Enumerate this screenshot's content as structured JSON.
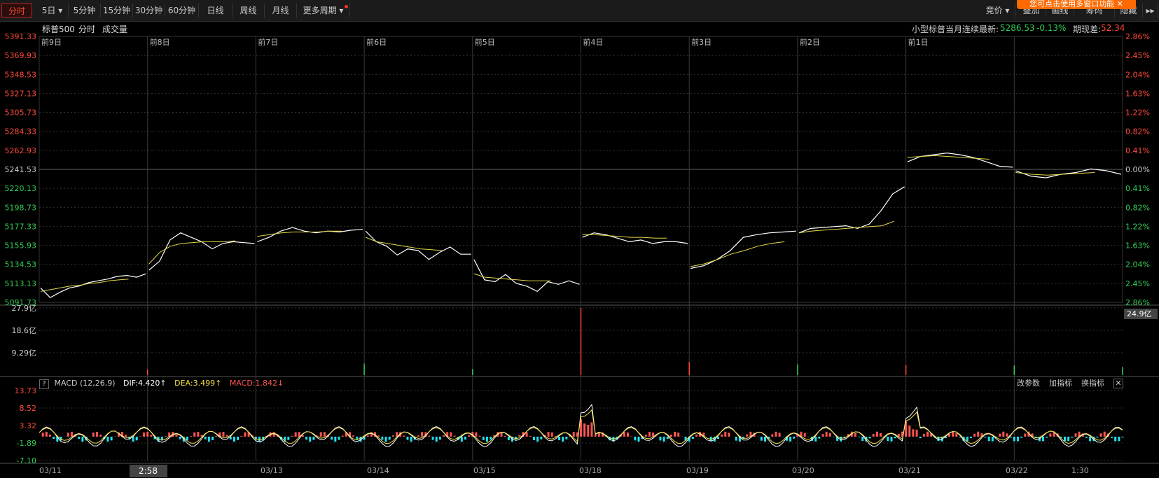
{
  "toolbar": {
    "tabs": [
      {
        "label": "分时",
        "active": true
      },
      {
        "label": "5日 ▾",
        "active": false
      },
      {
        "label": "5分钟",
        "active": false
      },
      {
        "label": "15分钟",
        "active": false
      },
      {
        "label": "30分钟",
        "active": false
      },
      {
        "label": "60分钟",
        "active": false
      },
      {
        "label": "日线",
        "active": false
      },
      {
        "label": "周线",
        "active": false
      },
      {
        "label": "月线",
        "active": false
      },
      {
        "label": "更多周期 ▾",
        "active": false
      }
    ],
    "right_buttons": [
      "竞价 ▾",
      "叠加",
      "画线",
      "筹码",
      "隐藏",
      "▸▸"
    ],
    "notice": "您可点击使用多窗口功能 ✕"
  },
  "header": {
    "symbol": "标普500",
    "mode": "分时",
    "volume_label": "成交量",
    "latest_label": "小型标普当月连续最新:",
    "latest_value": "5286.53",
    "latest_change": "-0.13%",
    "basis_label": "期现差:",
    "basis_value": "52.34"
  },
  "colors": {
    "up": "#ff4a3a",
    "down": "#33cc55",
    "price_line": "#ffffff",
    "avg_line": "#e6d84a",
    "dif_line": "#ffffff",
    "dea_line": "#f5e04a",
    "macd_pos": "#ff5555",
    "macd_neg": "#22e0ee",
    "grid": "#333333"
  },
  "chart_data": {
    "type": "line",
    "price_axis": {
      "ticks": [
        "5391.33",
        "5369.93",
        "5348.53",
        "5327.13",
        "5305.73",
        "5284.33",
        "5262.93",
        "5241.53",
        "5220.13",
        "5198.73",
        "5177.33",
        "5155.93",
        "5134.53",
        "5113.13",
        "5091.73"
      ],
      "pct_ticks": [
        "2.86%",
        "2.45%",
        "2.04%",
        "1.63%",
        "1.22%",
        "0.82%",
        "0.41%",
        "0.00%",
        "0.41%",
        "0.82%",
        "1.22%",
        "1.63%",
        "2.04%",
        "2.45%",
        "2.86%"
      ],
      "ylim": [
        5091.73,
        5391.33
      ],
      "base": 5241.53
    },
    "day_labels": [
      "前9日",
      "前8日",
      "前7日",
      "前6日",
      "前5日",
      "前4日",
      "前3日",
      "前2日",
      "前1日",
      ""
    ],
    "dates": [
      "03/11",
      "03/13",
      "03/14",
      "03/15",
      "03/18",
      "03/19",
      "03/20",
      "03/21",
      "03/22"
    ],
    "time_marks": [
      "2:58",
      "1:30"
    ],
    "days": [
      {
        "price": [
          5108,
          5097,
          5103,
          5108,
          5110,
          5114,
          5116,
          5118,
          5121,
          5122,
          5120,
          5124
        ],
        "avg": [
          5104,
          5106,
          5108,
          5110,
          5111,
          5113,
          5114,
          5116,
          5117,
          5118
        ]
      },
      {
        "price": [
          5128,
          5138,
          5162,
          5170,
          5165,
          5160,
          5152,
          5158,
          5160,
          5159,
          5158
        ],
        "avg": [
          5135,
          5148,
          5155,
          5158,
          5159,
          5160,
          5160,
          5160,
          5161
        ]
      },
      {
        "price": [
          5160,
          5165,
          5172,
          5176,
          5172,
          5170,
          5172,
          5171,
          5173,
          5174
        ],
        "avg": [
          5166,
          5168,
          5170,
          5171,
          5171,
          5171,
          5172,
          5172
        ]
      },
      {
        "price": [
          5172,
          5160,
          5155,
          5145,
          5152,
          5150,
          5140,
          5148,
          5154,
          5146,
          5146
        ],
        "avg": [
          5165,
          5160,
          5158,
          5156,
          5154,
          5152,
          5151,
          5150
        ]
      },
      {
        "price": [
          5140,
          5117,
          5115,
          5123,
          5113,
          5110,
          5104,
          5115,
          5112,
          5116,
          5112
        ],
        "avg": [
          5124,
          5120,
          5119,
          5118,
          5117,
          5116,
          5116,
          5116
        ]
      },
      {
        "price": [
          5165,
          5170,
          5168,
          5164,
          5160,
          5162,
          5158,
          5160,
          5160,
          5158
        ],
        "avg": [
          5168,
          5168,
          5167,
          5166,
          5165,
          5165,
          5164,
          5164
        ]
      },
      {
        "price": [
          5130,
          5133,
          5140,
          5150,
          5165,
          5168,
          5170,
          5171,
          5172
        ],
        "avg": [
          5132,
          5135,
          5140,
          5146,
          5150,
          5155,
          5158,
          5160
        ]
      },
      {
        "price": [
          5170,
          5175,
          5176,
          5177,
          5178,
          5175,
          5180,
          5195,
          5214,
          5222
        ],
        "avg": [
          5170,
          5172,
          5173,
          5174,
          5175,
          5176,
          5177,
          5178,
          5183
        ]
      },
      {
        "price": [
          5250,
          5256,
          5258,
          5260,
          5258,
          5255,
          5250,
          5245,
          5244
        ],
        "avg": [
          5255,
          5256,
          5257,
          5256,
          5255,
          5254,
          5253
        ]
      },
      {
        "price": [
          5240,
          5234,
          5232,
          5236,
          5238,
          5242,
          5240,
          5236
        ],
        "avg": [
          5238,
          5236,
          5235,
          5236,
          5237,
          5238
        ]
      }
    ],
    "volume_axis": {
      "ticks": [
        "27.9亿",
        "18.6亿",
        "9.29亿"
      ],
      "current": "24.9亿",
      "ylim": [
        0,
        27.9
      ]
    },
    "volume_spikes": [
      {
        "day": 1,
        "value": 2.3,
        "color": "up"
      },
      {
        "day": 3,
        "value": 4.8,
        "color": "down"
      },
      {
        "day": 4,
        "value": 2.5,
        "color": "down"
      },
      {
        "day": 5,
        "value": 27.9,
        "color": "up"
      },
      {
        "day": 6,
        "value": 5.5,
        "color": "up"
      },
      {
        "day": 7,
        "value": 4.5,
        "color": "down"
      },
      {
        "day": 8,
        "value": 4.2,
        "color": "up"
      },
      {
        "day": 9,
        "value": 4.0,
        "color": "down"
      },
      {
        "day": 10,
        "value": 3.4,
        "color": "down"
      }
    ],
    "macd": {
      "title": "MACD (12,26,9)",
      "dif": "DIF:4.420↑",
      "dea": "DEA:3.499↑",
      "macd": "MACD:1.842↓",
      "ticks": [
        "13.73",
        "8.52",
        "3.32",
        "-1.89",
        "-7.10"
      ],
      "ylim": [
        -7.1,
        13.73
      ]
    }
  },
  "macd_buttons": [
    "改参数",
    "加指标",
    "换指标",
    "✕"
  ],
  "help_icon": "?"
}
